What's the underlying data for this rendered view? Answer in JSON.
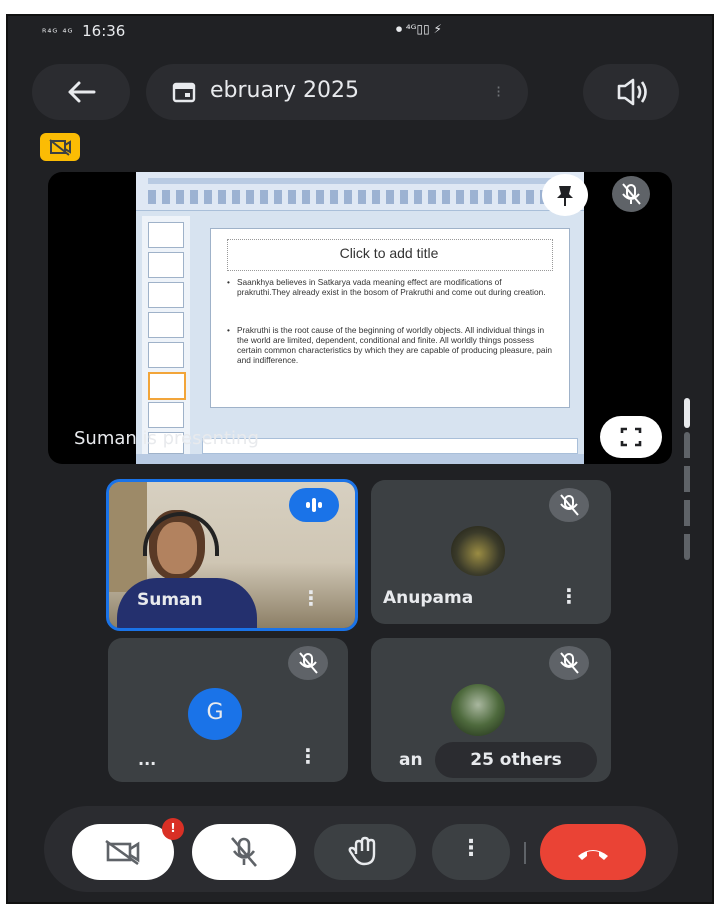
{
  "status_bar": {
    "time": "16:36",
    "left_signal": "ᴿ⁴ᴳ ⁴ᴳ",
    "right_icons": "⏺ ⁴ᴳ▯▯ ⚡"
  },
  "header": {
    "back_icon": "arrow-left-icon",
    "meeting_title": "ebruary 2025",
    "speaker_icon": "speaker-icon"
  },
  "presentation": {
    "caption": "Suman is presenting",
    "slide_title": "Click to add title",
    "bullets": [
      "Saankhya believes in Satkarya vada meaning effect are modifications of prakruthi.They already exist in the bosom of Prakruthi and come out during creation.",
      "Prakruthi is the root cause of the beginning of worldly objects. All individual things in the world are limited, dependent, conditional and finite. All worldly things possess certain common characteristics by which they are capable of producing pleasure, pain and indifference."
    ]
  },
  "participants": [
    {
      "name": "Suman",
      "speaking": true
    },
    {
      "name": "Anupama",
      "speaking": false
    },
    {
      "name": "...",
      "avatar_letter": "G",
      "speaking": false
    },
    {
      "name": "an",
      "others_label": "25 others",
      "speaking": false
    }
  ],
  "colors": {
    "accent_blue": "#1a73e8",
    "end_call_red": "#ea4335",
    "badge_yellow": "#fbbc04",
    "avatar_blue": "#1a73e8"
  },
  "controls": {
    "camera_badge": "!"
  }
}
